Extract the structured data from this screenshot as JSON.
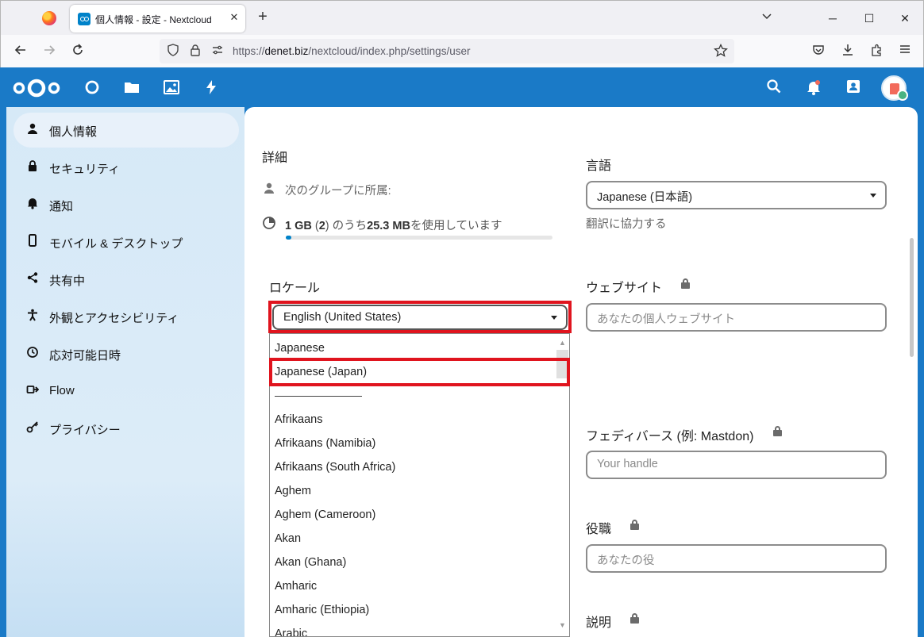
{
  "browser": {
    "tab_title": "個人情報 - 設定 - Nextcloud",
    "tab_close": "✕",
    "new_tab": "+",
    "url_prefix": "https://",
    "url_host": "denet.biz",
    "url_path": "/nextcloud/index.php/settings/user",
    "window_minimize": "─",
    "window_maximize": "☐",
    "window_close": "✕"
  },
  "sidebar": {
    "items": [
      {
        "label": "個人情報",
        "icon": "person-icon"
      },
      {
        "label": "セキュリティ",
        "icon": "lock-icon"
      },
      {
        "label": "通知",
        "icon": "bell-icon"
      },
      {
        "label": "モバイル & デスクトップ",
        "icon": "phone-icon"
      },
      {
        "label": "共有中",
        "icon": "share-icon"
      },
      {
        "label": "外観とアクセシビリティ",
        "icon": "accessibility-icon"
      },
      {
        "label": "応対可能日時",
        "icon": "clock-icon"
      },
      {
        "label": "Flow",
        "icon": "flow-icon"
      },
      {
        "label": "プライバシー",
        "icon": "key-icon"
      }
    ]
  },
  "details": {
    "title": "詳細",
    "groups_label": "次のグループに所属:",
    "quota_total": "1 GB",
    "quota_open": " (",
    "quota_groups": "2",
    "quota_mid": ") のうち",
    "quota_used": "25.3 MB",
    "quota_suffix": "を使用しています",
    "quota_percent": 2
  },
  "language": {
    "label": "言語",
    "value": "Japanese (日本語)",
    "help_link": "翻訳に協力する"
  },
  "locale": {
    "label": "ロケール",
    "value": "English (United States)",
    "options": [
      "Japanese",
      "Japanese (Japan)",
      "Afrikaans",
      "Afrikaans (Namibia)",
      "Afrikaans (South Africa)",
      "Aghem",
      "Aghem (Cameroon)",
      "Akan",
      "Akan (Ghana)",
      "Amharic",
      "Amharic (Ethiopia)",
      "Arabic"
    ],
    "highlighted_option": "Japanese (Japan)"
  },
  "website": {
    "label": "ウェブサイト",
    "placeholder": "あなたの個人ウェブサイト"
  },
  "fediverse": {
    "label": "フェディバース (例: Mastdon)",
    "placeholder": "Your handle"
  },
  "role": {
    "label": "役職",
    "placeholder": "あなたの役"
  },
  "description": {
    "label": "説明"
  },
  "colors": {
    "brand": "#1a7ac7",
    "highlight": "#e0141e",
    "quota": "#0082c9"
  }
}
